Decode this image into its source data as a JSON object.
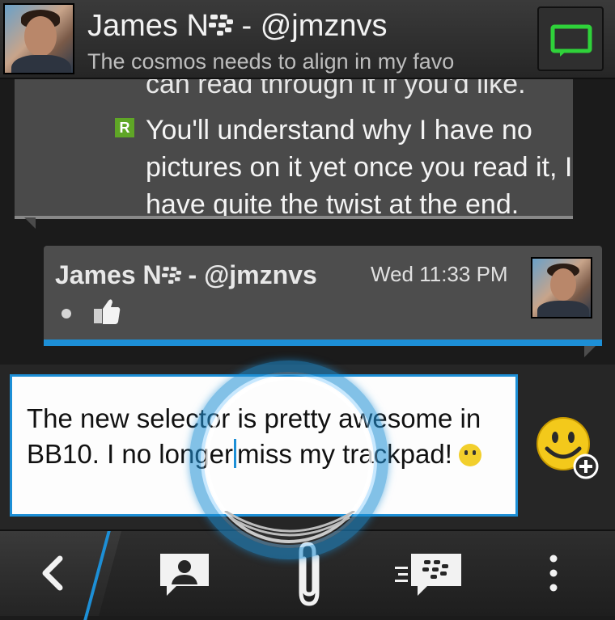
{
  "header": {
    "title": "James N⁝ - @jmznvs",
    "title_name": "James N",
    "title_handle": "- @jmznvs",
    "status": "The cosmos needs to align in my favo",
    "avatar_icon": "contact-avatar",
    "video_icon": "video-chat-icon",
    "video_color": "#2fd23a"
  },
  "messages": [
    {
      "clipped_line": "can read through it if you'd like.",
      "read_mark": "R",
      "text": "You'll understand why I have no pictures on it yet once you read it, I have quite the twist at the end."
    },
    {
      "sender": "James N⁝ - @jmznvs",
      "sender_name": "James N",
      "sender_handle": "- @jmznvs",
      "time": "Wed 11:33 PM",
      "status_icon": "thumbs-up-icon"
    }
  ],
  "compose": {
    "text_before_caret": "The new selector is pretty awesome in BB10. I no longer",
    "text_after_caret": "miss my trackpad!",
    "emoji_icon": "smiley-add-icon",
    "accent": "#1d8fd6"
  },
  "toolbar": {
    "items": [
      "back-icon",
      "contact-card-icon",
      "attach-paperclip-icon",
      "bbm-chats-icon",
      "overflow-menu-icon"
    ]
  }
}
